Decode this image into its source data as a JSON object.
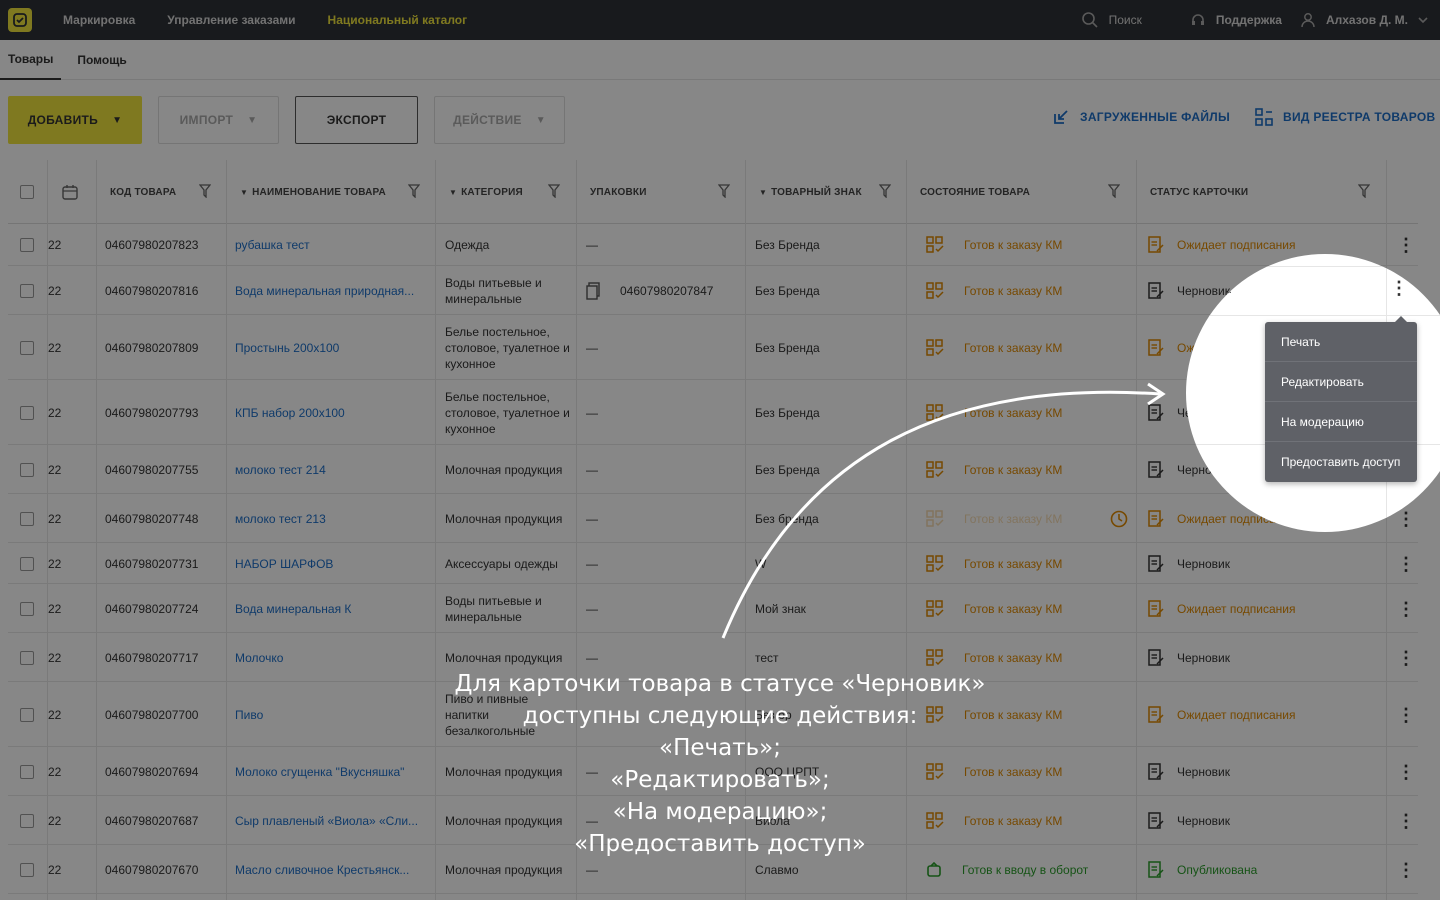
{
  "topbar": {
    "nav": [
      "Маркировка",
      "Управление заказами",
      "Национальный каталог"
    ],
    "search": "Поиск",
    "support": "Поддержка",
    "user": "Алхазов Д. М."
  },
  "tabs": [
    "Товары",
    "Помощь"
  ],
  "toolbar": {
    "add": "ДОБАВИТЬ",
    "import": "ИМПОРТ",
    "export": "ЭКСПОРТ",
    "action": "ДЕЙСТВИЕ",
    "uploaded_files": "ЗАГРУЖЕННЫЕ ФАЙЛЫ",
    "registry_view": "ВИД РЕЕСТРА ТОВАРОВ"
  },
  "columns": {
    "code": "КОД ТОВАРА",
    "name": "НАИМЕНОВАНИЕ ТОВАРА",
    "category": "КАТЕГОРИЯ",
    "packages": "УПАКОВКИ",
    "brand": "ТОВАРНЫЙ ЗНАК",
    "state": "СОСТОЯНИЕ ТОВАРА",
    "card_status": "СТАТУС КАРТОЧКИ"
  },
  "rows": [
    {
      "date": "22",
      "code": "04607980207823",
      "name": "рубашка тест",
      "category": "Одежда",
      "pack": "—",
      "brand": "Без Бренда",
      "state": "Готов к заказу КМ",
      "status": "Ожидает подписания"
    },
    {
      "date": "22",
      "code": "04607980207816",
      "name": "Вода минеральная природная...",
      "category": "Воды питьевые и минеральные",
      "pack": "04607980207847",
      "brand": "Без Бренда",
      "state": "Готов к заказу КМ",
      "status": "Черновик"
    },
    {
      "date": "22",
      "code": "04607980207809",
      "name": "Простынь 200х100",
      "category": "Белье постельное, столовое, туалетное и кухонное",
      "pack": "—",
      "brand": "Без Бренда",
      "state": "Готов к заказу КМ",
      "status": "Ожидает подписания"
    },
    {
      "date": "22",
      "code": "04607980207793",
      "name": "КПБ набор 200х100",
      "category": "Белье постельное, столовое, туалетное и кухонное",
      "pack": "—",
      "brand": "Без Бренда",
      "state": "Готов к заказу КМ",
      "status": "Черновик"
    },
    {
      "date": "22",
      "code": "04607980207755",
      "name": "молоко тест 214",
      "category": "Молочная продукция",
      "pack": "—",
      "brand": "Без Бренда",
      "state": "Готов к заказу КМ",
      "status": "Черновик"
    },
    {
      "date": "22",
      "code": "04607980207748",
      "name": "молоко тест 213",
      "category": "Молочная продукция",
      "pack": "—",
      "brand": "Без бренда",
      "state": "Готов к заказу КМ",
      "status": "Ожидает подписания"
    },
    {
      "date": "22",
      "code": "04607980207731",
      "name": "НАБОР ШАРФОВ",
      "category": "Аксессуары одежды",
      "pack": "—",
      "brand": "W",
      "state": "Готов к заказу КМ",
      "status": "Черновик"
    },
    {
      "date": "22",
      "code": "04607980207724",
      "name": "Вода минеральная К",
      "category": "Воды питьевые и минеральные",
      "pack": "—",
      "brand": "Мой знак",
      "state": "Готов к заказу КМ",
      "status": "Ожидает подписания"
    },
    {
      "date": "22",
      "code": "04607980207717",
      "name": "Молочко",
      "category": "Молочная продукция",
      "pack": "—",
      "brand": "тест",
      "state": "Готов к заказу КМ",
      "status": "Черновик"
    },
    {
      "date": "22",
      "code": "04607980207700",
      "name": "Пиво",
      "category": "Пиво и пивные напитки безалкогольные",
      "pack": "",
      "brand": "Без бр",
      "state": "Готов к заказу КМ",
      "status": "Ожидает подписания"
    },
    {
      "date": "22",
      "code": "04607980207694",
      "name": "Молоко сгущенка \"Вкусняшка\"",
      "category": "Молочная продукция",
      "pack": "—",
      "brand": "ООО ЦРПТ",
      "state": "Готов к заказу КМ",
      "status": "Черновик"
    },
    {
      "date": "22",
      "code": "04607980207687",
      "name": "Сыр плавленый «Виола» «Сли...",
      "category": "Молочная продукция",
      "pack": "—",
      "brand": "Виола",
      "state": "Готов к заказу КМ",
      "status": "Черновик"
    },
    {
      "date": "22",
      "code": "04607980207670",
      "name": "Масло сливочное Крестьянск...",
      "category": "Молочная продукция",
      "pack": "—",
      "brand": "Славмо",
      "state": "Готов к вводу в оборот",
      "status": "Опубликована"
    }
  ],
  "menu": [
    "Печать",
    "Редактировать",
    "На модерацию",
    "Предоставить доступ"
  ],
  "caption": [
    "Для карточки товара в статусе «Черновик»",
    "доступны следующие действия:",
    "«Печать»;",
    "«Редактировать»;",
    "«На модерацию»;",
    "«Предоставить доступ»"
  ],
  "colors": {
    "accent": "#f0e53d",
    "link": "#1e6fc8",
    "orange": "#e08a00",
    "green": "#2a9d2a",
    "dark": "#2f3237"
  }
}
